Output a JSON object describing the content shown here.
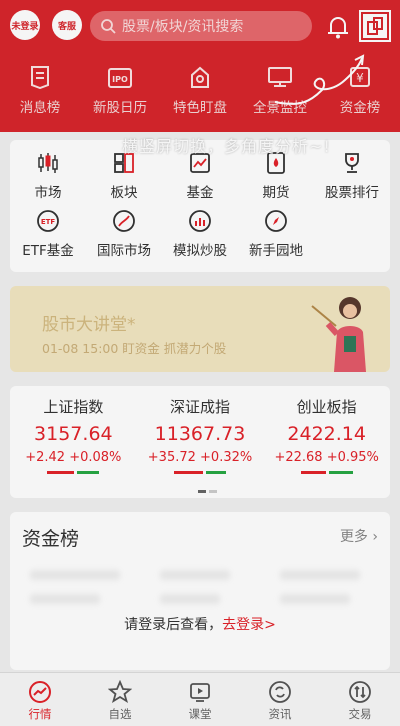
{
  "header": {
    "login_badge": "未登录",
    "service_badge": "客服",
    "search_placeholder": "股票/板块/资讯搜索"
  },
  "quick_nav": [
    {
      "label": "消息榜",
      "icon": "news-list-icon"
    },
    {
      "label": "新股日历",
      "icon": "ipo-calendar-icon"
    },
    {
      "label": "特色盯盘",
      "icon": "watch-icon"
    },
    {
      "label": "全景监控",
      "icon": "monitor-icon"
    },
    {
      "label": "资金榜",
      "icon": "fund-rank-icon"
    }
  ],
  "tip": "横竖屏切换，多角度分析~!",
  "menu": [
    {
      "label": "市场",
      "icon": "candlestick-icon"
    },
    {
      "label": "板块",
      "icon": "blocks-icon"
    },
    {
      "label": "基金",
      "icon": "fund-chart-icon"
    },
    {
      "label": "期货",
      "icon": "futures-icon"
    },
    {
      "label": "股票排行",
      "icon": "trophy-icon"
    },
    {
      "label": "ETF基金",
      "icon": "etf-icon"
    },
    {
      "label": "国际市场",
      "icon": "globe-icon"
    },
    {
      "label": "模拟炒股",
      "icon": "simulation-icon"
    },
    {
      "label": "新手园地",
      "icon": "compass-icon"
    }
  ],
  "banner": {
    "title": "股市大讲堂*",
    "subtitle": "01-08 15:00 盯资金 抓潜力个股"
  },
  "indices": [
    {
      "name": "上证指数",
      "value": "3157.64",
      "change": "+2.42",
      "pct": "+0.08%",
      "up_fraction": 0.55
    },
    {
      "name": "深证成指",
      "value": "11367.73",
      "change": "+35.72",
      "pct": "+0.32%",
      "up_fraction": 0.6
    },
    {
      "name": "创业板指",
      "value": "2422.14",
      "change": "+22.68",
      "pct": "+0.95%",
      "up_fraction": 0.5
    }
  ],
  "fund_rank": {
    "title": "资金榜",
    "more": "更多 ›",
    "login_prompt": "请登录后查看，",
    "login_link": "去登录>"
  },
  "tabs": [
    {
      "label": "行情",
      "icon": "market-trend-icon",
      "active": true
    },
    {
      "label": "自选",
      "icon": "star-icon",
      "active": false
    },
    {
      "label": "课堂",
      "icon": "play-icon",
      "active": false
    },
    {
      "label": "资讯",
      "icon": "refresh-icon",
      "active": false
    },
    {
      "label": "交易",
      "icon": "trade-icon",
      "active": false
    }
  ],
  "colors": {
    "brand_red": "#d8262c",
    "up_red": "#e2232a",
    "down_green": "#27a844"
  }
}
